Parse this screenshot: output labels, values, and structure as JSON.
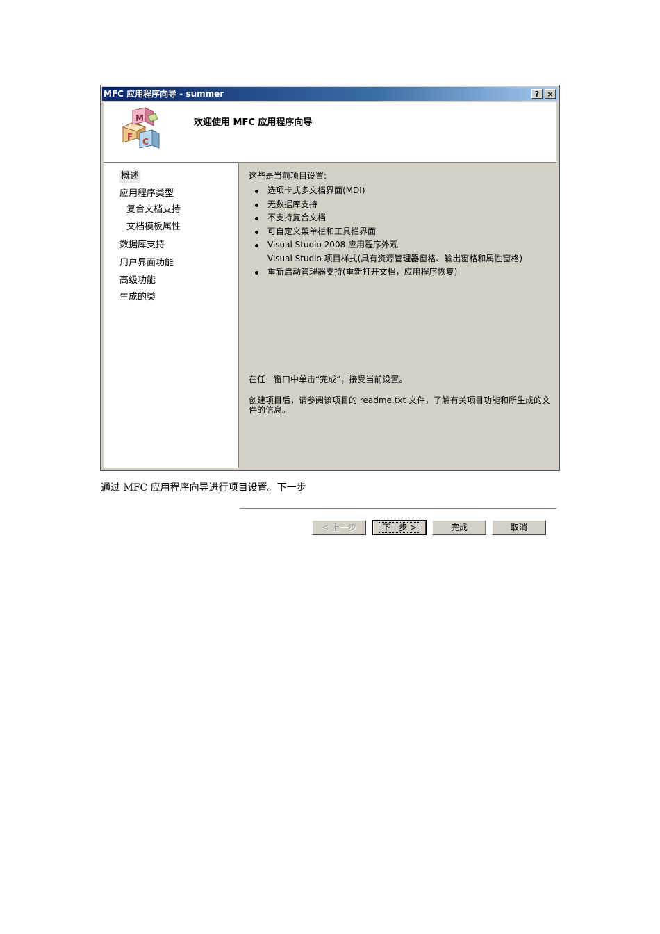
{
  "window": {
    "title": "MFC 应用程序向导 - summer",
    "help_label": "?",
    "close_label": "×"
  },
  "header": {
    "welcome": "欢迎使用 MFC 应用程序向导"
  },
  "nav": {
    "items": [
      {
        "label": "概述"
      },
      {
        "label": "应用程序类型"
      },
      {
        "label": "复合文档支持"
      },
      {
        "label": "文档模板属性"
      },
      {
        "label": "数据库支持"
      },
      {
        "label": "用户界面功能"
      },
      {
        "label": "高级功能"
      },
      {
        "label": "生成的类"
      }
    ]
  },
  "content": {
    "intro": "这些是当前项目设置:",
    "bullets": [
      "选项卡式多文档界面(MDI)",
      "无数据库支持",
      "不支持复合文档",
      "可自定义菜单栏和工具栏界面",
      "Visual Studio 2008 应用程序外观",
      "Visual Studio 项目样式(具有资源管理器窗格、输出窗格和属性窗格)",
      "重新启动管理器支持(重新打开文档，应用程序恢复)"
    ],
    "para1": "在任一窗口中单击“完成”，接受当前设置。",
    "para2": "创建项目后，请参阅该项目的 readme.txt 文件，了解有关项目功能和所生成的文件的信息。"
  },
  "buttons": {
    "back": "< 上一步",
    "next": "下一步 >",
    "finish": "完成",
    "cancel": "取消"
  },
  "caption": "通过 MFC 应用程序向导进行项目设置。下一步"
}
